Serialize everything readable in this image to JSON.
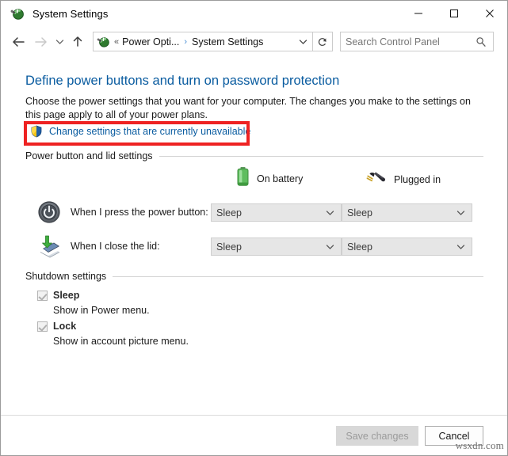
{
  "window": {
    "title": "System Settings",
    "title_icon": "power-options-icon",
    "controls": {
      "minimize": "minimize-icon",
      "maximize": "maximize-icon",
      "close": "close-icon"
    }
  },
  "nav": {
    "back_icon": "back-arrow-icon",
    "forward_icon": "forward-arrow-icon",
    "recent_icon": "recent-locations-chevron-icon",
    "up_icon": "up-arrow-icon",
    "address_icon": "power-options-icon",
    "overflow_chevron": "«",
    "crumbs": [
      "Power Opti...",
      "System Settings"
    ],
    "crumb_separator": "›",
    "address_dropdown_icon": "chevron-down-icon",
    "refresh_icon": "refresh-icon"
  },
  "search": {
    "placeholder": "Search Control Panel",
    "value": "",
    "icon": "search-icon"
  },
  "main": {
    "page_title": "Define power buttons and turn on password protection",
    "description": "Choose the power settings that you want for your computer. The changes you make to the settings on this page apply to all of your power plans.",
    "uac_link": "Change settings that are currently unavailable",
    "uac_icon": "uac-shield-icon",
    "highlight_color": "#ee2222",
    "link_color": "#0a5ca0"
  },
  "power_section": {
    "heading": "Power button and lid settings",
    "columns": [
      {
        "label": "On battery",
        "icon": "battery-icon"
      },
      {
        "label": "Plugged in",
        "icon": "power-plug-icon"
      }
    ],
    "rows": [
      {
        "label": "When I press the power button:",
        "icon": "power-button-icon",
        "on_battery": "Sleep",
        "plugged_in": "Sleep"
      },
      {
        "label": "When I close the lid:",
        "icon": "laptop-lid-icon",
        "on_battery": "Sleep",
        "plugged_in": "Sleep"
      }
    ],
    "dropdown_chevron": "chevron-down-icon"
  },
  "shutdown_section": {
    "heading": "Shutdown settings",
    "items": [
      {
        "label": "Sleep",
        "description": "Show in Power menu.",
        "checked": true,
        "disabled": true
      },
      {
        "label": "Lock",
        "description": "Show in account picture menu.",
        "checked": true,
        "disabled": true
      }
    ]
  },
  "footer": {
    "save_label": "Save changes",
    "save_disabled": true,
    "cancel_label": "Cancel"
  },
  "watermark": "wsxdn.com"
}
